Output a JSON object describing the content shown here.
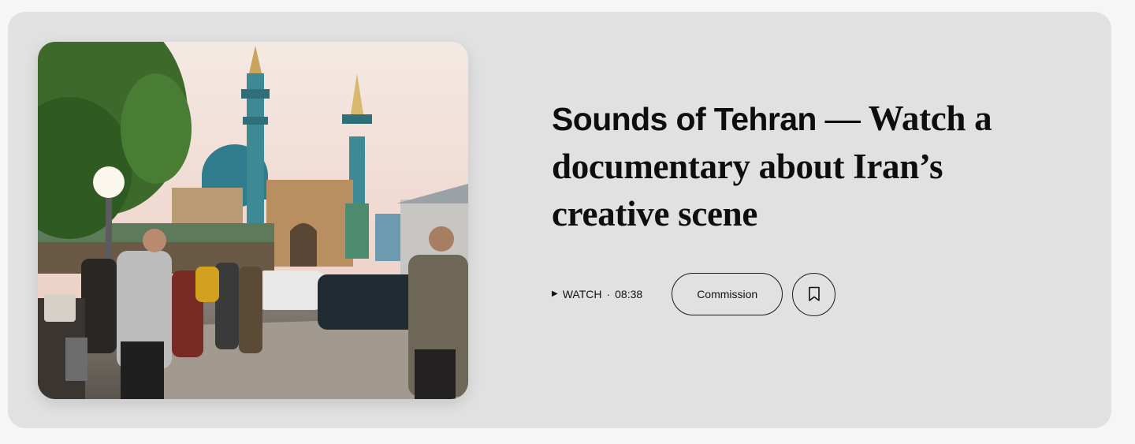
{
  "article": {
    "title_lead": "Sounds of Tehran",
    "title_rest": " — Watch a documentary about Iran’s creative scene",
    "image_icon": "photo-mosque-street-scene"
  },
  "meta": {
    "watch_label": "WATCH",
    "separator": "·",
    "duration": "08:38",
    "play_icon": "play-icon",
    "commission_label": "Commission",
    "bookmark_icon": "bookmark-icon"
  },
  "colors": {
    "card_bg": "#e1e1e1",
    "page_bg": "#f6f6f6",
    "text": "#111111"
  }
}
